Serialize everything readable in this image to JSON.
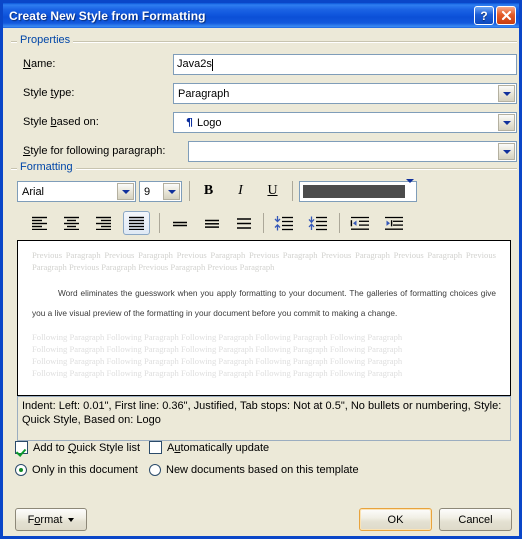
{
  "window": {
    "title": "Create New Style from Formatting",
    "help_button": "?",
    "close_button": "✕"
  },
  "properties": {
    "group_label": "Properties",
    "name_label": "Name:",
    "name_value": "Java2s",
    "style_type_label": "Style type:",
    "style_type_value": "Paragraph",
    "style_based_on_label": "Style based on:",
    "style_based_on_value": "Logo",
    "style_based_on_icon": "¶",
    "style_following_label": "Style for following paragraph:",
    "style_following_value": ""
  },
  "formatting": {
    "group_label": "Formatting",
    "font_family_value": "Arial",
    "font_size_value": "9",
    "bold_label": "B",
    "italic_label": "I",
    "underline_label": "U",
    "font_color_hex": "#4c4c4c",
    "align_left": "align-left",
    "align_center": "align-center",
    "align_right": "align-right",
    "align_justify": "align-justify",
    "selected_alignment": "align-justify",
    "line_spacing_single": "line-spacing-1",
    "line_spacing_1_5": "line-spacing-1.5",
    "line_spacing_double": "line-spacing-2",
    "spacing_before": "decrease-paragraph-spacing",
    "spacing_after": "increase-paragraph-spacing",
    "decrease_indent": "decrease-indent",
    "increase_indent": "increase-indent"
  },
  "preview": {
    "previous_paragraph_text": "Previous Paragraph Previous Paragraph Previous Paragraph Previous Paragraph Previous Paragraph Previous Paragraph Previous Paragraph Previous Paragraph Previous Paragraph Previous Paragraph",
    "sample_text": "Word eliminates the guesswork when you apply formatting to your document. The galleries of formatting choices give you a live visual preview of the formatting in your document before you commit to making a change.",
    "following_paragraph_line": "Following Paragraph Following Paragraph Following Paragraph Following Paragraph Following Paragraph"
  },
  "description": {
    "text": "Indent: Left:  0.01\", First line:  0.36\", Justified, Tab stops: Not at  0.5\",  No bullets or numbering, Style: Quick Style, Based on: Logo"
  },
  "options": {
    "add_to_quick_style_label": "Add to Quick Style list",
    "add_to_quick_style_checked": true,
    "automatically_update_label": "Automatically update",
    "automatically_update_checked": false,
    "only_this_document_label": "Only in this document",
    "only_this_document_selected": true,
    "new_documents_label": "New documents based on this template",
    "new_documents_selected": false
  },
  "buttons": {
    "format_label": "Format",
    "ok_label": "OK",
    "cancel_label": "Cancel"
  },
  "colors": {
    "title_bar_blue": "#0a4fd6",
    "group_label_blue": "#0046a8",
    "dialog_face": "#ece9d8",
    "default_button_border": "#e8a33d"
  }
}
